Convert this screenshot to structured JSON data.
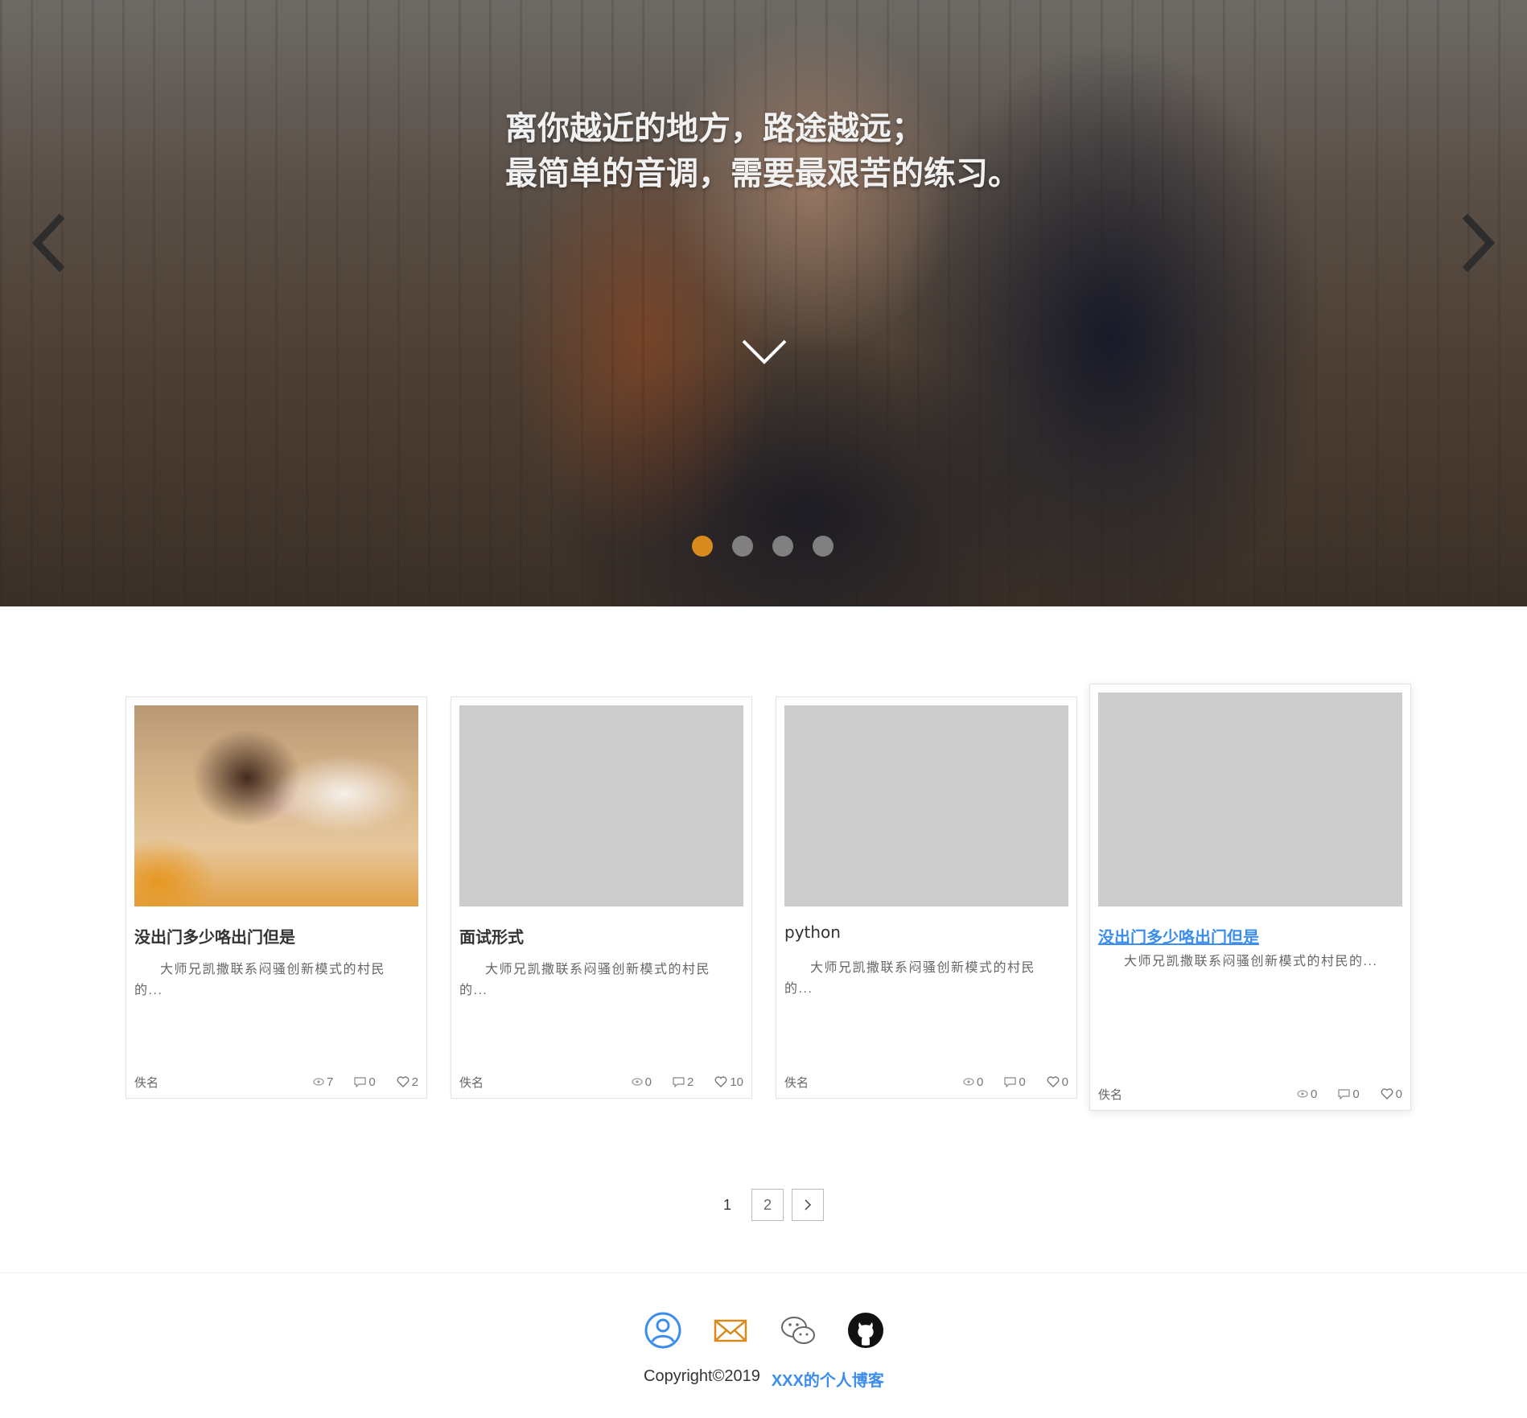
{
  "hero": {
    "quote_line1": "离你越近的地方，路途越远；",
    "quote_line2": "最简单的音调，需要最艰苦的练习。",
    "dots_count": 4,
    "active_dot": 1
  },
  "posts": [
    {
      "title": "没出门多少咯出门但是",
      "excerpt": "大师兄凯撒联系闷骚创新模式的村民的...",
      "author": "佚名",
      "views": "7",
      "comments": "0",
      "likes": "2",
      "thumbnail": "photo"
    },
    {
      "title": "面试形式",
      "excerpt": "大师兄凯撒联系闷骚创新模式的村民的...",
      "author": "佚名",
      "views": "0",
      "comments": "2",
      "likes": "10",
      "thumbnail": "placeholder"
    },
    {
      "title": "python",
      "excerpt": "大师兄凯撒联系闷骚创新模式的村民的...",
      "author": "佚名",
      "views": "0",
      "comments": "0",
      "likes": "0",
      "thumbnail": "placeholder"
    },
    {
      "title": "没出门多少咯出门但是",
      "excerpt": "大师兄凯撒联系闷骚创新模式的村民的...",
      "author": "佚名",
      "views": "0",
      "comments": "0",
      "likes": "0",
      "thumbnail": "placeholder",
      "hovered": true
    }
  ],
  "pagination": {
    "pages": [
      "1",
      "2"
    ],
    "current": "1",
    "next_icon": "chevron-right-icon"
  },
  "footer": {
    "social_icons": [
      "user-circle-icon",
      "mail-icon",
      "wechat-icon",
      "github-icon"
    ],
    "copyright": "Copyright©2019",
    "blog_name": "XXX的个人博客"
  },
  "colors": {
    "accent_orange": "#d98a1c",
    "link_blue": "#3d8eec",
    "placeholder_gray": "#cccccc"
  }
}
